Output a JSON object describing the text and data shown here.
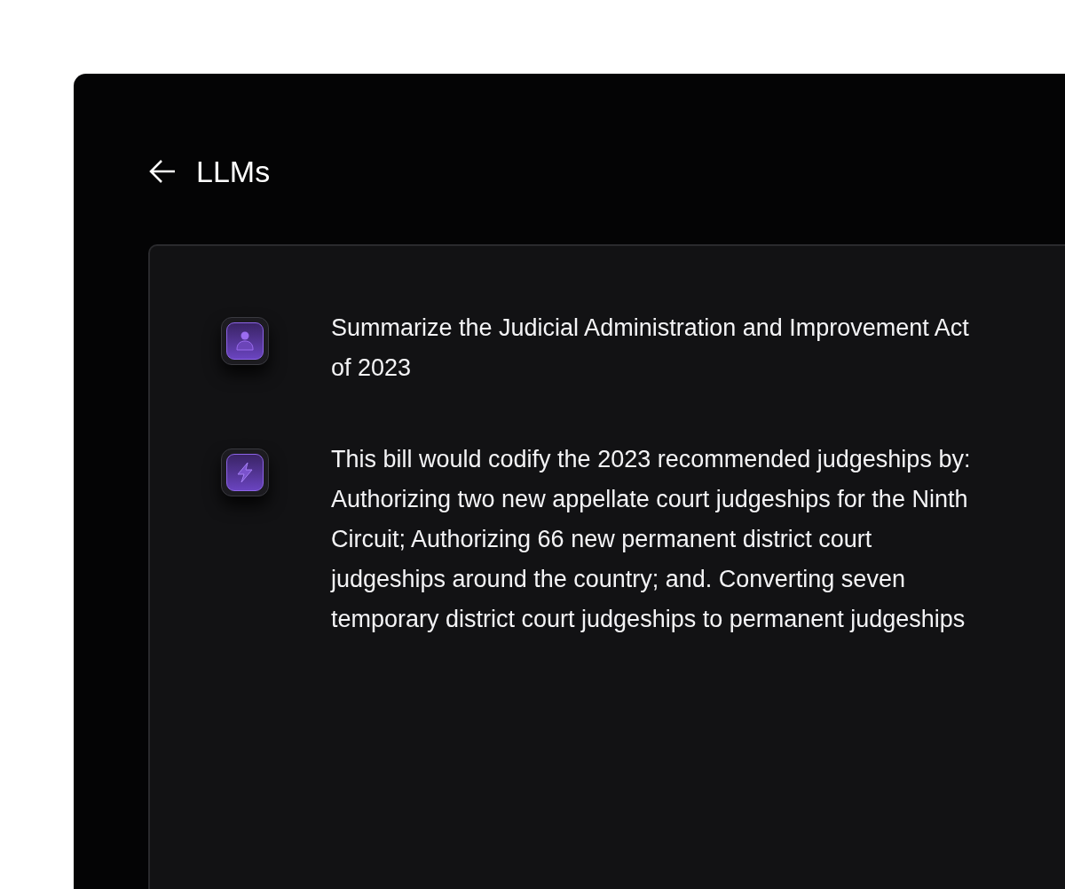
{
  "header": {
    "title": "LLMs"
  },
  "messages": [
    {
      "kind": "user",
      "text": "Summarize the Judicial Administration and Improvement Act of 2023"
    },
    {
      "kind": "assistant",
      "text": "This bill would codify the 2023 recommended judgeships by: Authorizing two new appellate court judgeships for the Ninth Circuit; Authorizing 66 new permanent district court judgeships around the country; and. Converting seven temporary district court judgeships to permanent judgeships"
    }
  ]
}
